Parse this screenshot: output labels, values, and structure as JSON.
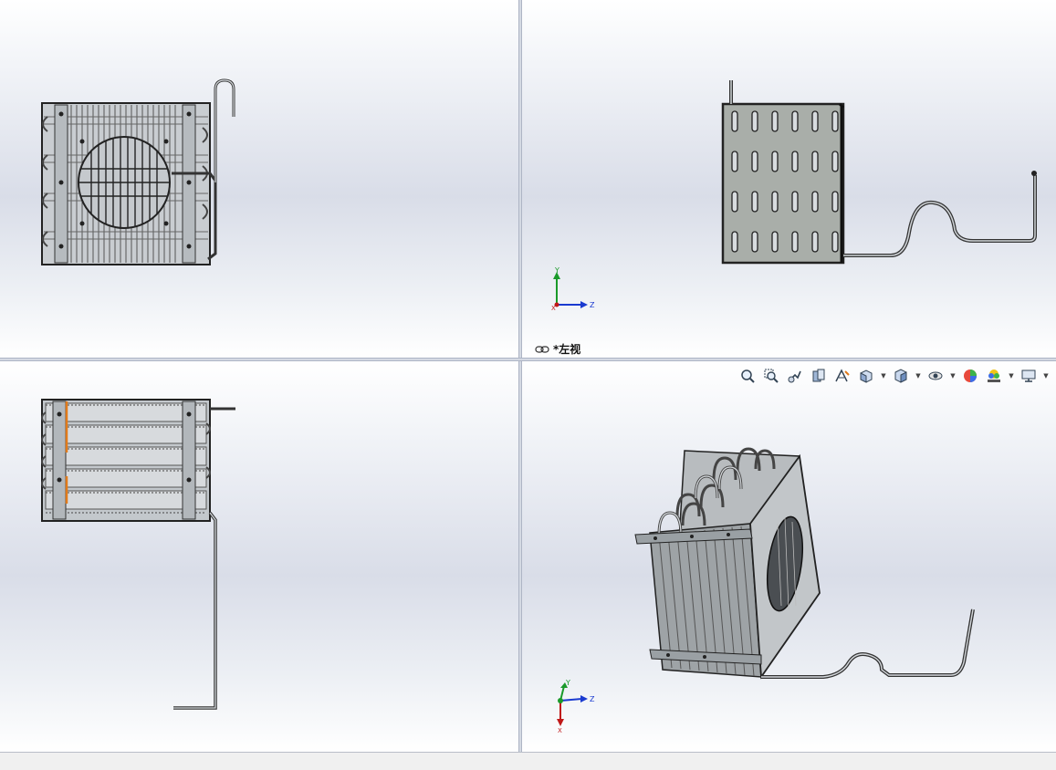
{
  "views": {
    "top_right": {
      "label": "*左视",
      "triad": {
        "axis_y": "Y",
        "axis_z": "Z",
        "axis_x": "X"
      }
    },
    "bottom_right": {
      "triad": {
        "axis_y": "Y",
        "axis_z": "Z",
        "axis_x": "X"
      }
    }
  },
  "heads_up_toolbar": {
    "icons": [
      "zoom-to-fit-icon",
      "zoom-to-area-icon",
      "previous-view-icon",
      "section-view-icon",
      "dynamic-annotation-icon",
      "view-orientation-icon",
      "display-style-icon",
      "hide-show-items-icon",
      "edit-appearance-icon",
      "apply-scene-icon",
      "view-settings-icon"
    ]
  },
  "colors": {
    "viewport_bg_mid": "#d9dde8",
    "part_outline": "#222222",
    "fin_fill": "#a9aea9",
    "tube_fill": "#c8ccd0",
    "accent_orange": "#e07a1a",
    "axis_y": "#1a9a2a",
    "axis_z": "#1a3ad0",
    "axis_x": "#c01818"
  }
}
